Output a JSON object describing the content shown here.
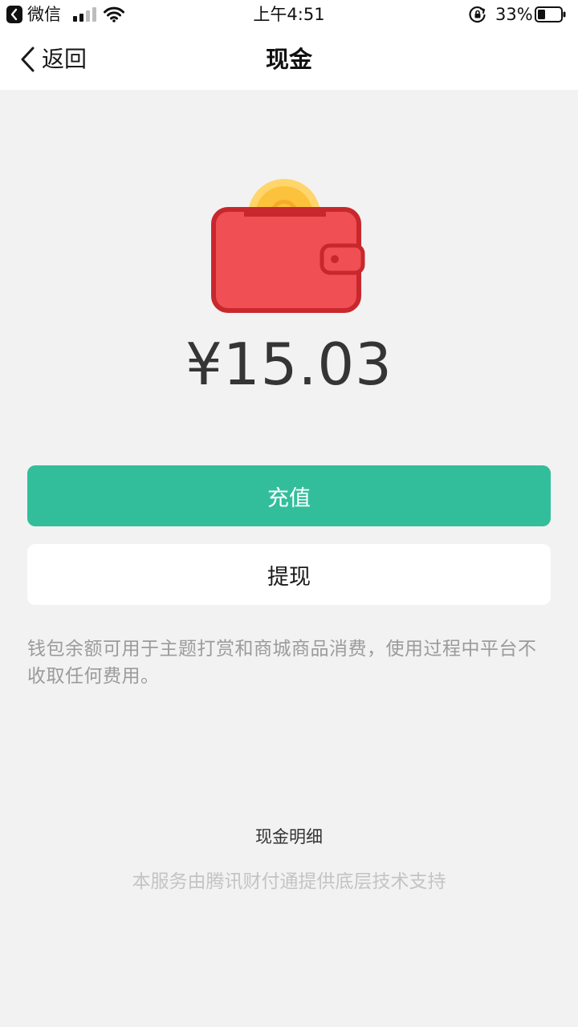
{
  "status_bar": {
    "app_name": "微信",
    "time": "上午4:51",
    "battery_percent": "33%",
    "battery_level": 0.33
  },
  "nav": {
    "back_label": "返回",
    "title": "现金"
  },
  "wallet": {
    "balance": "¥15.03"
  },
  "actions": {
    "recharge_label": "充值",
    "withdraw_label": "提现"
  },
  "note": "钱包余额可用于主题打赏和商城商品消费，使用过程中平台不收取任何费用。",
  "detail_link": "现金明细",
  "footer": "本服务由腾讯财付通提供底层技术支持",
  "colors": {
    "accent": "#33be9b",
    "wallet_red": "#f05054",
    "coin_gold": "#fcc23c"
  }
}
